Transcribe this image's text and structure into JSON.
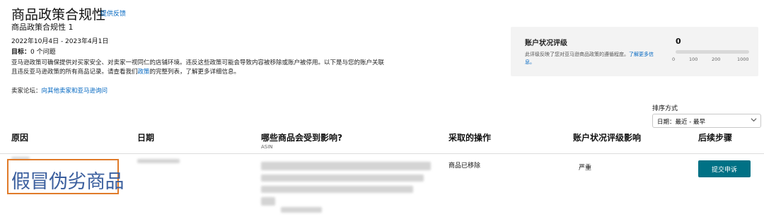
{
  "header": {
    "title": "商品政策合规性",
    "feedback_link": "提供反馈",
    "subtitle": "商品政策合规性 1",
    "date_range": "2022年10月4日 - 2023年4月1日",
    "target_label": "目标：",
    "target_value": "0 个问题",
    "description_part1": "亚马逊政策可确保提供对买家安全、对卖家一视同仁的店铺环境。违反这些政策可能会导致内容被移除或账户被停用。以下是与您的账户关联且违反亚马逊政策的所有商品记录。请查看我们",
    "description_link": "政策",
    "description_part2": "的完整列表，了解更多详细信息。",
    "forum_label": "卖家论坛：",
    "forum_link": "向其他卖家和亚马逊询问"
  },
  "health_card": {
    "title": "账户状况评级",
    "desc_part1": "此评级反映了您对亚马逊商品政策的遵循程度。",
    "desc_link": "了解更多信息。",
    "score": "0",
    "ticks": [
      "0",
      "100",
      "200",
      "1000"
    ]
  },
  "sort": {
    "label": "排序方式",
    "selected": "日期：最近 - 最早"
  },
  "table": {
    "headers": {
      "reason": "原因",
      "date": "日期",
      "items": "哪些商品会受到影响?",
      "items_sub": "ASIN",
      "action": "采取的操作",
      "impact": "账户状况评级影响",
      "next": "后续步骤"
    },
    "rows": [
      {
        "reason": "假冒伪劣商品",
        "action": "商品已移除",
        "impact": "严重",
        "next_button": "提交申诉"
      }
    ]
  },
  "colors": {
    "link": "#0066c0",
    "button": "#007185",
    "highlight_border": "#e07b2a",
    "reason_text": "#3b5f9e"
  }
}
